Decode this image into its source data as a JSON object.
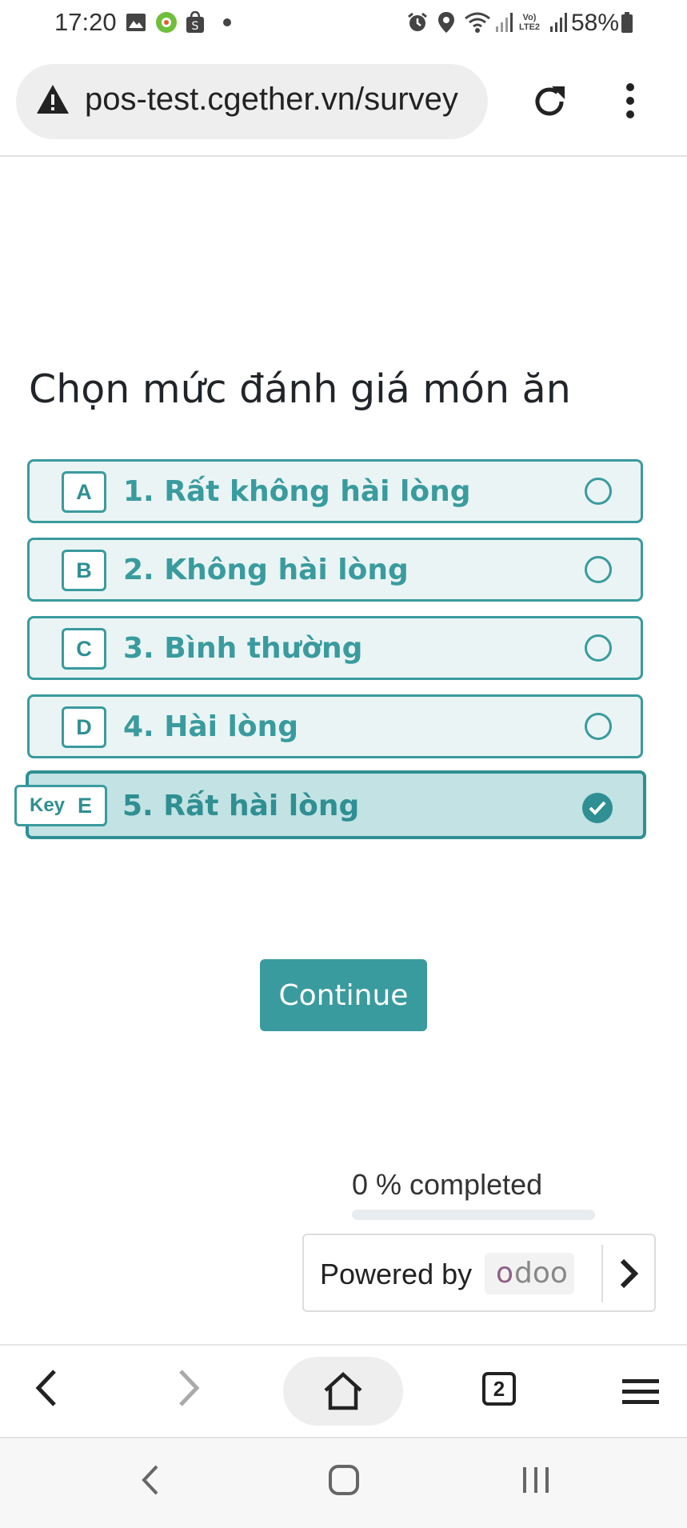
{
  "status_bar": {
    "time": "17:20",
    "battery": "58%",
    "left_icons": [
      "image-icon",
      "app-icon",
      "shopee-icon",
      "dot-icon"
    ],
    "right_icons": [
      "alarm-icon",
      "location-icon",
      "wifi-icon",
      "signal-icon",
      "volte-icon",
      "signal-icon",
      "battery-icon"
    ],
    "network_label": "Vo) LTE2"
  },
  "browser": {
    "url": "pos-test.cgether.vn/survey",
    "security_icon": "warning-icon"
  },
  "survey": {
    "question": "Chọn mức đánh giá món ăn",
    "choices": [
      {
        "key": "A",
        "label": "1. Rất không hài lòng",
        "selected": false
      },
      {
        "key": "B",
        "label": "2. Không hài lòng",
        "selected": false
      },
      {
        "key": "C",
        "label": "3. Bình thường",
        "selected": false
      },
      {
        "key": "D",
        "label": "4. Hài lòng",
        "selected": false
      },
      {
        "key": "E",
        "key_prefix": "Key",
        "label": "5. Rất hài lòng",
        "selected": true
      }
    ],
    "continue_label": "Continue",
    "progress_label": "0 % completed",
    "progress_value": 0
  },
  "footer": {
    "powered_by": "Powered by",
    "brand": "odoo",
    "brand_color": "#8f5f86"
  },
  "colors": {
    "accent": "#3a9b9e",
    "choice_bg": "#eaf4f4",
    "selected_bg": "#c2e2e4"
  }
}
